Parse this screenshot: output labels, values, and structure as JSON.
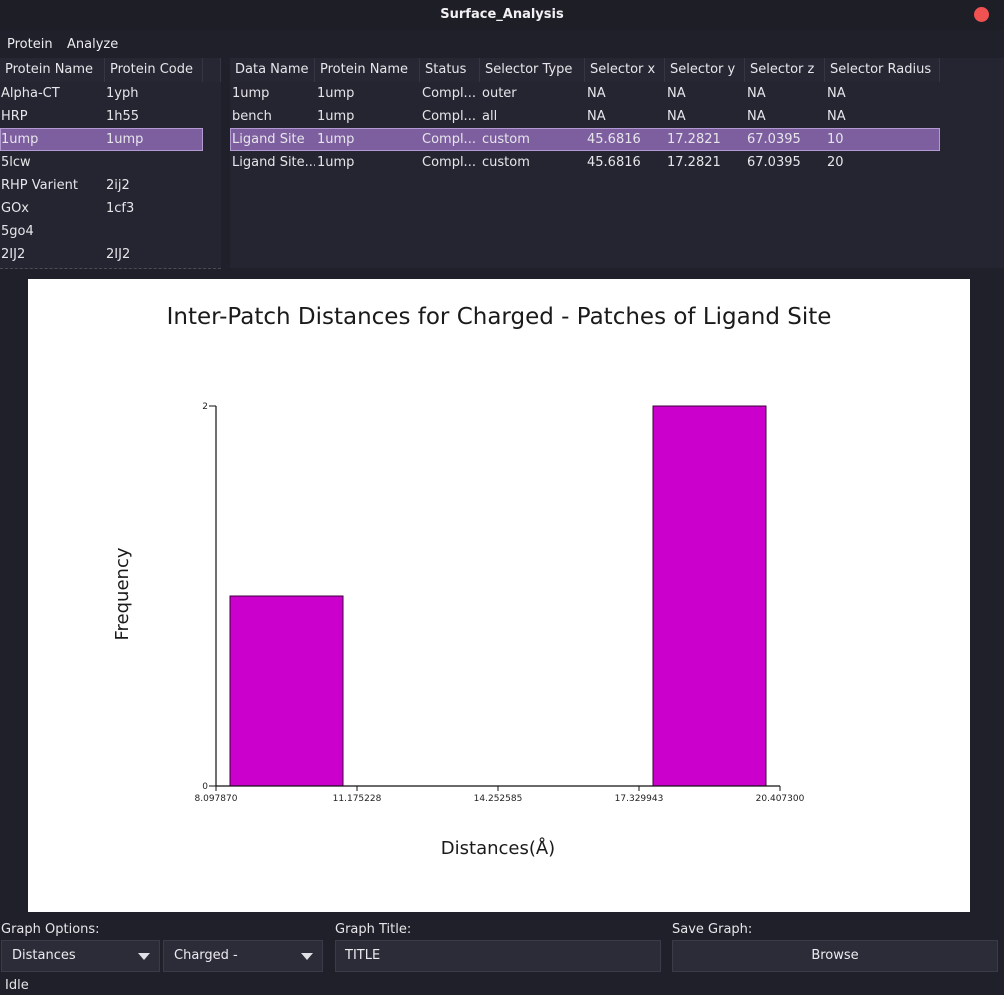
{
  "window": {
    "title": "Surface_Analysis"
  },
  "menu": {
    "items": [
      "Protein",
      "Analyze"
    ]
  },
  "protein_table": {
    "columns": [
      "Protein Name",
      "Protein Code",
      ""
    ],
    "rows": [
      [
        "Alpha-CT",
        "1yph"
      ],
      [
        "HRP",
        "1h55"
      ],
      [
        "1ump",
        "1ump"
      ],
      [
        "5lcw",
        ""
      ],
      [
        "RHP Varient",
        "2ij2"
      ],
      [
        "GOx",
        "1cf3"
      ],
      [
        "5go4",
        ""
      ],
      [
        "2IJ2",
        "2IJ2"
      ]
    ],
    "selected_row": 2
  },
  "data_table": {
    "columns": [
      "Data Name",
      "Protein Name",
      "Status",
      "Selector Type",
      "Selector x",
      "Selector y",
      "Selector z",
      "Selector Radius"
    ],
    "rows": [
      [
        "1ump",
        "1ump",
        "Compl...",
        "outer",
        "NA",
        "NA",
        "NA",
        "NA"
      ],
      [
        "bench",
        "1ump",
        "Compl...",
        "all",
        "NA",
        "NA",
        "NA",
        "NA"
      ],
      [
        "Ligand Site",
        "1ump",
        "Compl...",
        "custom",
        "45.6816",
        "17.2821",
        "67.0395",
        "10"
      ],
      [
        "Ligand Site...",
        "1ump",
        "Compl...",
        "custom",
        "45.6816",
        "17.2821",
        "67.0395",
        "20"
      ]
    ],
    "selected_row": 2
  },
  "chart_data": {
    "type": "bar",
    "title": "Inter-Patch Distances for Charged - Patches of Ligand Site",
    "xlabel": "Distances(Å)",
    "ylabel": "Frequency",
    "xlim": [
      8.09787,
      20.4073
    ],
    "ylim": [
      0,
      2
    ],
    "x_ticks": [
      "8.097870",
      "11.175228",
      "14.252585",
      "17.329943",
      "20.407300"
    ],
    "y_ticks": [
      "0",
      "2"
    ],
    "bars": [
      {
        "x0": 8.09787,
        "x1": 11.175228,
        "value": 1
      },
      {
        "x0": 17.329943,
        "x1": 20.4073,
        "value": 2
      }
    ],
    "bar_color": "#cc00cc",
    "grid": false
  },
  "controls": {
    "graph_options_label": "Graph Options:",
    "graph_type_value": "Distances",
    "patch_type_value": "Charged -",
    "graph_title_label": "Graph Title:",
    "graph_title_value": "TITLE",
    "save_graph_label": "Save Graph:",
    "browse_label": "Browse"
  },
  "status": {
    "text": "Idle"
  }
}
